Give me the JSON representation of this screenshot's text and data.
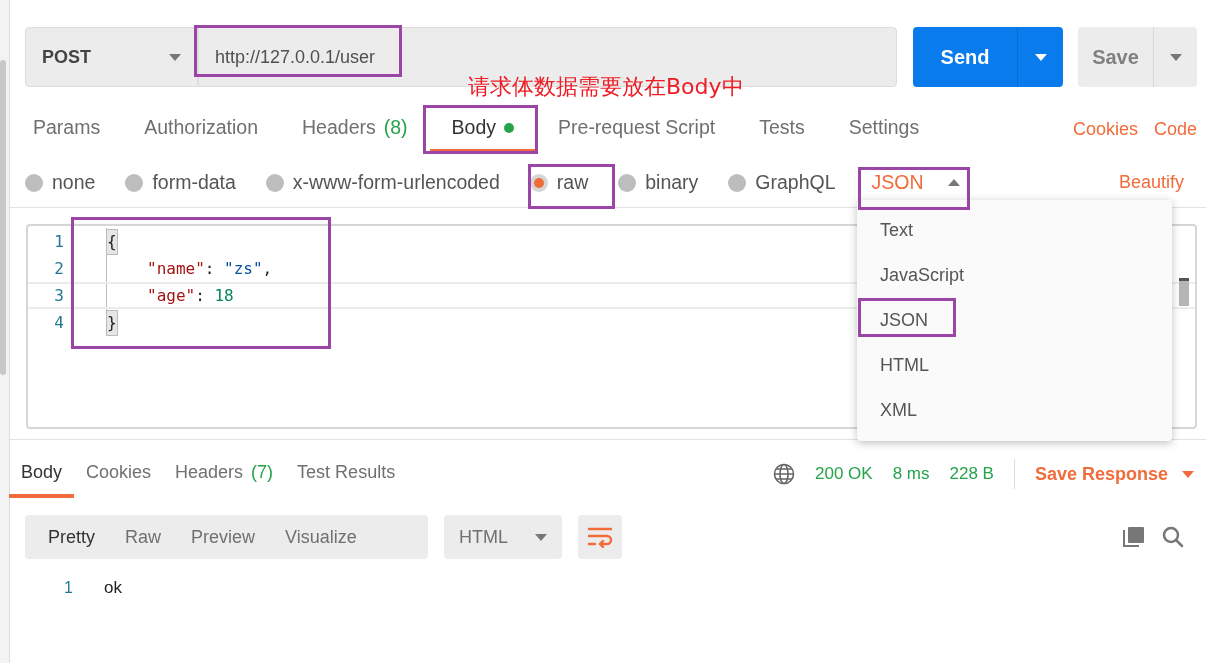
{
  "request": {
    "method": "POST",
    "url": "http://127.0.0.1/user",
    "send": "Send",
    "save": "Save"
  },
  "annotation": "请求体数据需要放在Body中",
  "request_tabs": [
    {
      "label": "Params",
      "selected": false,
      "dot": false
    },
    {
      "label": "Authorization",
      "selected": false,
      "dot": false
    },
    {
      "label": "Headers",
      "count": "(8)",
      "selected": false,
      "dot": false
    },
    {
      "label": "Body",
      "selected": true,
      "dot": true
    },
    {
      "label": "Pre-request Script",
      "selected": false,
      "dot": false
    },
    {
      "label": "Tests",
      "selected": false,
      "dot": false
    },
    {
      "label": "Settings",
      "selected": false,
      "dot": false
    }
  ],
  "request_links": [
    "Cookies",
    "Code"
  ],
  "body_types": [
    {
      "label": "none",
      "selected": false
    },
    {
      "label": "form-data",
      "selected": false
    },
    {
      "label": "x-www-form-urlencoded",
      "selected": false
    },
    {
      "label": "raw",
      "selected": true
    },
    {
      "label": "binary",
      "selected": false
    },
    {
      "label": "GraphQL",
      "selected": false
    }
  ],
  "language_dropdown": {
    "value": "JSON",
    "expanded": true,
    "options": [
      "Text",
      "JavaScript",
      "JSON",
      "HTML",
      "XML"
    ]
  },
  "beautify": "Beautify",
  "editor_lines": [
    {
      "number": "1",
      "active": false,
      "tokens": [
        {
          "kind": "bracket",
          "text": "{"
        }
      ]
    },
    {
      "number": "2",
      "active": false,
      "tokens": [
        {
          "kind": "key",
          "text": "\"name\""
        },
        {
          "kind": "punct",
          "text": ": "
        },
        {
          "kind": "string",
          "text": "\"zs\""
        },
        {
          "kind": "punct",
          "text": ","
        }
      ]
    },
    {
      "number": "3",
      "active": true,
      "tokens": [
        {
          "kind": "key",
          "text": "\"age\""
        },
        {
          "kind": "punct",
          "text": ": "
        },
        {
          "kind": "number",
          "text": "18"
        }
      ]
    },
    {
      "number": "4",
      "active": false,
      "tokens": [
        {
          "kind": "bracket",
          "text": "}"
        }
      ]
    }
  ],
  "response": {
    "tabs": [
      {
        "label": "Body",
        "selected": true
      },
      {
        "label": "Cookies",
        "selected": false
      },
      {
        "label": "Headers",
        "count": "(7)",
        "selected": false
      },
      {
        "label": "Test Results",
        "selected": false
      }
    ],
    "status": "200 OK",
    "time": "8 ms",
    "size": "228 B",
    "save_response": "Save Response",
    "views": [
      {
        "label": "Pretty",
        "selected": true
      },
      {
        "label": "Raw",
        "selected": false
      },
      {
        "label": "Preview",
        "selected": false
      },
      {
        "label": "Visualize",
        "selected": false
      }
    ],
    "format": "HTML",
    "lines": [
      {
        "number": "1",
        "text": "ok"
      }
    ]
  }
}
